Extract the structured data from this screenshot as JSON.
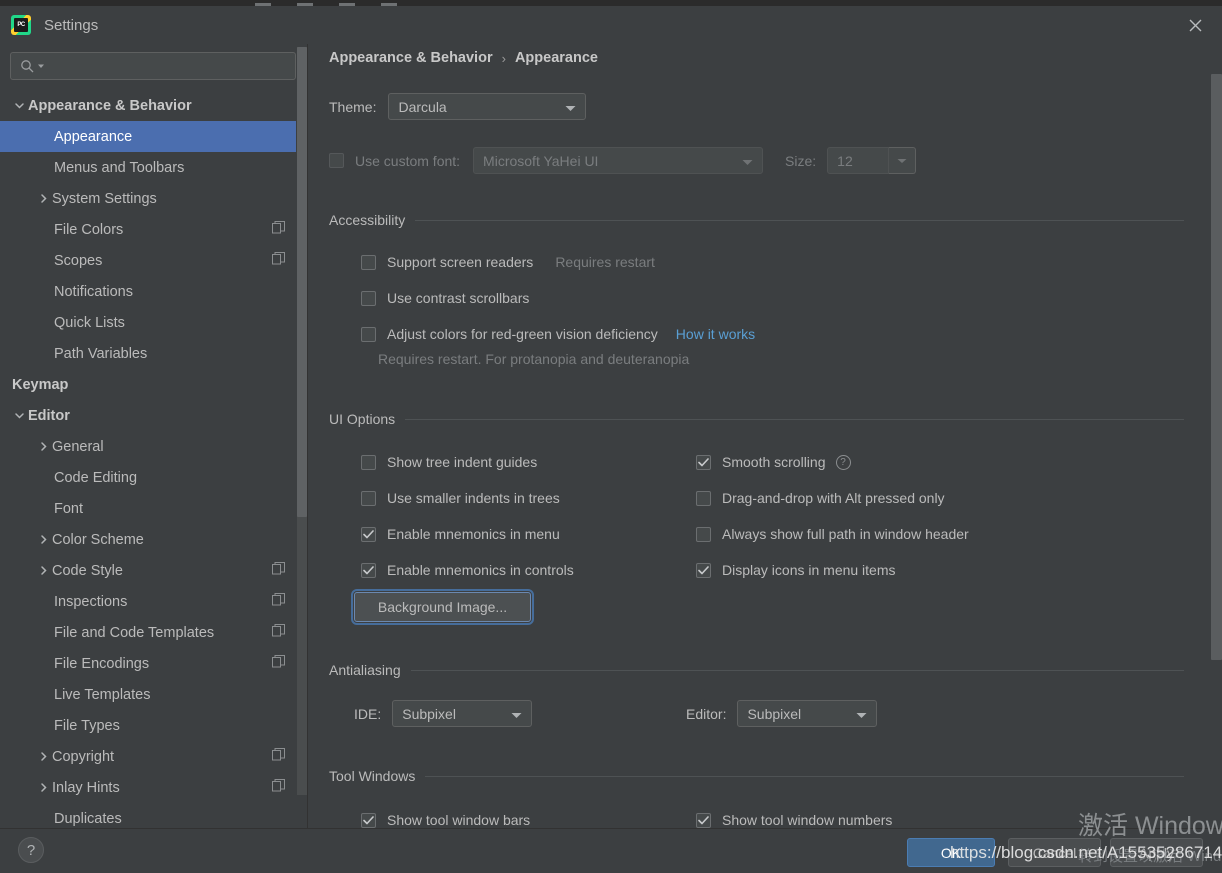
{
  "window": {
    "title": "Settings",
    "logo_text": "PC",
    "close_icon": "close-icon"
  },
  "sidebar": {
    "search": {
      "value": "",
      "placeholder": ""
    },
    "items": [
      {
        "label": "Appearance & Behavior",
        "indent": 0,
        "arrow": "down",
        "bold": true,
        "selected": false,
        "badge": false
      },
      {
        "label": "Appearance",
        "indent": 1,
        "arrow": "none",
        "bold": false,
        "selected": true,
        "badge": false
      },
      {
        "label": "Menus and Toolbars",
        "indent": 1,
        "arrow": "none",
        "bold": false,
        "selected": false,
        "badge": false
      },
      {
        "label": "System Settings",
        "indent": 1,
        "arrow": "right",
        "bold": false,
        "selected": false,
        "badge": false
      },
      {
        "label": "File Colors",
        "indent": 1,
        "arrow": "none",
        "bold": false,
        "selected": false,
        "badge": true
      },
      {
        "label": "Scopes",
        "indent": 1,
        "arrow": "none",
        "bold": false,
        "selected": false,
        "badge": true
      },
      {
        "label": "Notifications",
        "indent": 1,
        "arrow": "none",
        "bold": false,
        "selected": false,
        "badge": false
      },
      {
        "label": "Quick Lists",
        "indent": 1,
        "arrow": "none",
        "bold": false,
        "selected": false,
        "badge": false
      },
      {
        "label": "Path Variables",
        "indent": 1,
        "arrow": "none",
        "bold": false,
        "selected": false,
        "badge": false
      },
      {
        "label": "Keymap",
        "indent": 0,
        "arrow": "none",
        "bold": true,
        "selected": false,
        "badge": false
      },
      {
        "label": "Editor",
        "indent": 0,
        "arrow": "down",
        "bold": true,
        "selected": false,
        "badge": false
      },
      {
        "label": "General",
        "indent": 1,
        "arrow": "right",
        "bold": false,
        "selected": false,
        "badge": false
      },
      {
        "label": "Code Editing",
        "indent": 1,
        "arrow": "none",
        "bold": false,
        "selected": false,
        "badge": false
      },
      {
        "label": "Font",
        "indent": 1,
        "arrow": "none",
        "bold": false,
        "selected": false,
        "badge": false
      },
      {
        "label": "Color Scheme",
        "indent": 1,
        "arrow": "right",
        "bold": false,
        "selected": false,
        "badge": false
      },
      {
        "label": "Code Style",
        "indent": 1,
        "arrow": "right",
        "bold": false,
        "selected": false,
        "badge": true
      },
      {
        "label": "Inspections",
        "indent": 1,
        "arrow": "none",
        "bold": false,
        "selected": false,
        "badge": true
      },
      {
        "label": "File and Code Templates",
        "indent": 1,
        "arrow": "none",
        "bold": false,
        "selected": false,
        "badge": true
      },
      {
        "label": "File Encodings",
        "indent": 1,
        "arrow": "none",
        "bold": false,
        "selected": false,
        "badge": true
      },
      {
        "label": "Live Templates",
        "indent": 1,
        "arrow": "none",
        "bold": false,
        "selected": false,
        "badge": false
      },
      {
        "label": "File Types",
        "indent": 1,
        "arrow": "none",
        "bold": false,
        "selected": false,
        "badge": false
      },
      {
        "label": "Copyright",
        "indent": 1,
        "arrow": "right",
        "bold": false,
        "selected": false,
        "badge": true
      },
      {
        "label": "Inlay Hints",
        "indent": 1,
        "arrow": "right",
        "bold": false,
        "selected": false,
        "badge": true
      },
      {
        "label": "Duplicates",
        "indent": 1,
        "arrow": "none",
        "bold": false,
        "selected": false,
        "badge": false
      }
    ]
  },
  "breadcrumb": {
    "parent": "Appearance & Behavior",
    "separator": "›",
    "current": "Appearance"
  },
  "theme_row": {
    "label": "Theme:",
    "value": "Darcula"
  },
  "font_row": {
    "checkbox_label": "Use custom font:",
    "checked": false,
    "font_value": "Microsoft YaHei UI",
    "size_label": "Size:",
    "size_value": "12"
  },
  "accessibility": {
    "title": "Accessibility",
    "options": [
      {
        "label": "Support screen readers",
        "checked": false,
        "hint": "Requires restart",
        "link": ""
      },
      {
        "label": "Use contrast scrollbars",
        "checked": false,
        "hint": "",
        "link": ""
      },
      {
        "label": "Adjust colors for red-green vision deficiency",
        "checked": false,
        "hint": "",
        "link": "How it works"
      }
    ],
    "note": "Requires restart. For protanopia and deuteranopia"
  },
  "ui_options": {
    "title": "UI Options",
    "left": [
      {
        "label": "Show tree indent guides",
        "checked": false,
        "help": false
      },
      {
        "label": "Use smaller indents in trees",
        "checked": false,
        "help": false
      },
      {
        "label": "Enable mnemonics in menu",
        "checked": true,
        "help": false
      },
      {
        "label": "Enable mnemonics in controls",
        "checked": true,
        "help": false
      }
    ],
    "right": [
      {
        "label": "Smooth scrolling",
        "checked": true,
        "help": true
      },
      {
        "label": "Drag-and-drop with Alt pressed only",
        "checked": false,
        "help": false
      },
      {
        "label": "Always show full path in window header",
        "checked": false,
        "help": false
      },
      {
        "label": "Display icons in menu items",
        "checked": true,
        "help": false
      }
    ],
    "background_image_button": "Background Image..."
  },
  "antialiasing": {
    "title": "Antialiasing",
    "ide_label": "IDE:",
    "ide_value": "Subpixel",
    "editor_label": "Editor:",
    "editor_value": "Subpixel"
  },
  "tool_windows": {
    "title": "Tool Windows",
    "left": [
      {
        "label": "Show tool window bars",
        "checked": true
      }
    ],
    "right": [
      {
        "label": "Show tool window numbers",
        "checked": true
      }
    ]
  },
  "footer": {
    "help_label": "?",
    "ok": "OK",
    "cancel": "Cancel",
    "apply": "Apply"
  },
  "watermarks": {
    "url": "https://blog.csdn.net/A15535286714",
    "windows_line1": "激活 Windows",
    "windows_line2": "转到设置以激活 Windows"
  },
  "colors": {
    "bg": "#3c3f41",
    "selection": "#4b6eaf",
    "accent_blue": "#41688f",
    "link": "#5a9fd4",
    "text": "#bbbbbb",
    "text_dim": "#7a7d7f"
  }
}
